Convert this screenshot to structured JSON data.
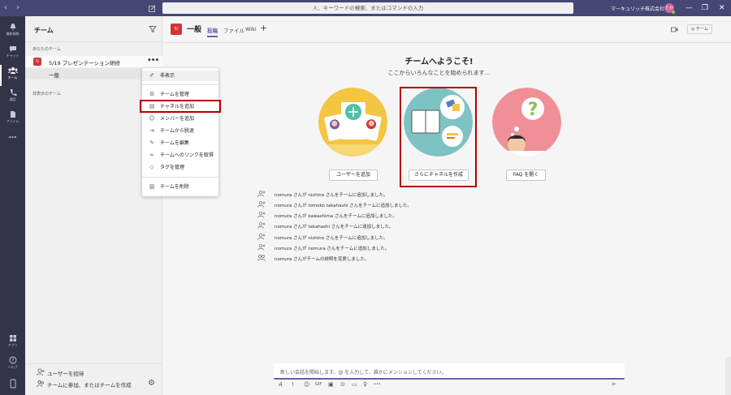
{
  "titlebar": {
    "search_placeholder": "人、キーワードの検索、またはコマンドの入力",
    "org_name": "マーキュリッチ株式会社",
    "avatar_initials": "とか",
    "back_glyph": "‹",
    "forward_glyph": "›",
    "min_glyph": "—",
    "restore_glyph": "❐",
    "close_glyph": "✕"
  },
  "rail": {
    "items": [
      {
        "label": "最新情報",
        "icon": "bell-icon"
      },
      {
        "label": "チャット",
        "icon": "chat-icon"
      },
      {
        "label": "チーム",
        "icon": "teams-icon",
        "active": true
      },
      {
        "label": "通話",
        "icon": "phone-icon"
      },
      {
        "label": "ファイル",
        "icon": "file-icon"
      },
      {
        "label": "…",
        "icon": "more-icon"
      }
    ],
    "bottom_items": [
      {
        "label": "アプリ",
        "icon": "apps-icon"
      },
      {
        "label": "ヘルプ",
        "icon": "help-icon"
      },
      {
        "label": "",
        "icon": "device-icon"
      }
    ]
  },
  "sidebar": {
    "title": "チーム",
    "your_teams_label": "あなたのチーム",
    "team": {
      "avatar": "5/",
      "name": "5/19 プレゼンテーション研修",
      "more": "•••"
    },
    "channel": {
      "name": "一般"
    },
    "hidden_teams_label": "非表示のチーム",
    "invite_label": "ユーザーを招待",
    "join_create_label": "チームに参加、またはチームを作成",
    "gear_glyph": "⚙"
  },
  "context_menu": {
    "items": [
      {
        "label": "非表示",
        "icon": "hide-icon",
        "glyph": "✐"
      },
      {
        "label": "チームを管理",
        "icon": "manage-team-icon",
        "glyph": "⚙"
      },
      {
        "label": "チャネルを追加",
        "icon": "add-channel-icon",
        "glyph": "▤",
        "highlighted": true
      },
      {
        "label": "メンバーを追加",
        "icon": "add-member-icon",
        "glyph": "☺"
      },
      {
        "label": "チームから脱退",
        "icon": "leave-team-icon",
        "glyph": "⇥"
      },
      {
        "label": "チームを編集",
        "icon": "edit-icon",
        "glyph": "✎"
      },
      {
        "label": "チームへのリンクを取得",
        "icon": "link-icon",
        "glyph": "∞"
      },
      {
        "label": "タグを管理",
        "icon": "tag-icon",
        "glyph": "◇"
      },
      {
        "label": "チームを削除",
        "icon": "delete-icon",
        "glyph": "▥"
      }
    ]
  },
  "channel_header": {
    "avatar": "5/",
    "name": "一般",
    "tabs": [
      {
        "label": "投稿",
        "active": true
      },
      {
        "label": "ファイル"
      },
      {
        "label": "Wiki"
      }
    ],
    "add_tab_glyph": "+",
    "team_button": "◎ チーム"
  },
  "welcome": {
    "title": "チームへようこそ!",
    "subtitle": "ここからいろんなことを始められます…",
    "cards": [
      {
        "button": "ユーザーを追加"
      },
      {
        "button": "さらにチャネルを作成",
        "highlighted": true
      },
      {
        "button": "FAQ を開く"
      }
    ]
  },
  "activity": [
    "nomura さんが nishino さんをチームに追加しました。",
    "nomura さんが tomoko takahashi さんをチームに追加しました。",
    "nomura さんが kawashima さんをチームに追加しました。",
    "nomura さんが takahashi さんをチームに追加しました。",
    "nomura さんが nishino さんをチームに追加しました。",
    "nomura さんが nomura さんをチームに追加しました。",
    "nomura さんがチームの説明を変更しました。"
  ],
  "compose": {
    "placeholder": "新しい会話を開始します。@ を入力して、誰かにメンションしてください。",
    "tools": [
      "A",
      "!",
      "☺",
      "GIF",
      "▣",
      "⊙",
      "▭",
      "♀",
      "•••"
    ],
    "send_glyph": "➢"
  },
  "colors": {
    "titlebar": "#464775",
    "rail": "#33344a",
    "accent": "#6264a7",
    "team_avatar": "#d13438",
    "highlight_box": "#b40000"
  }
}
